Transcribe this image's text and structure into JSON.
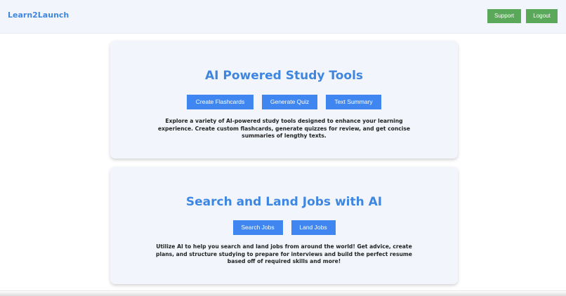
{
  "header": {
    "logo": "Learn2Launch",
    "support_label": "Support",
    "logout_label": "Logout"
  },
  "study_tools": {
    "title": "AI Powered Study Tools",
    "buttons": [
      "Create Flashcards",
      "Generate Quiz",
      "Text Summary"
    ],
    "description": "Explore a variety of AI-powered study tools designed to enhance your learning experience. Create custom flashcards, generate quizzes for review, and get concise summaries of lengthy texts."
  },
  "jobs": {
    "title": "Search and Land Jobs with AI",
    "buttons": [
      "Search Jobs",
      "Land Jobs"
    ],
    "description": "Utilize AI to help you search and land jobs from around the world! Get advice, create plans, and structure studying to prepare for interviews and build the perfect resume based off of required skills and more!"
  },
  "colors": {
    "accent_blue": "#3f86f0",
    "nav_green": "#5aa95a",
    "card_bg": "#f2f6fc"
  }
}
